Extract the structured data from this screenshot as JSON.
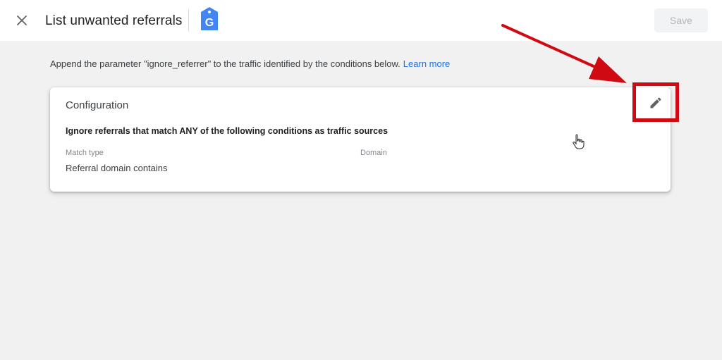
{
  "header": {
    "title": "List unwanted referrals",
    "save_label": "Save",
    "logo_letter": "G"
  },
  "description": {
    "text": "Append the parameter \"ignore_referrer\" to the traffic identified by the conditions below.",
    "link": "Learn more"
  },
  "configuration": {
    "title": "Configuration",
    "subtitle": "Ignore referrals that match ANY of the following conditions as traffic sources",
    "columns": [
      "Match type",
      "Domain"
    ],
    "match_type_value": "Referral domain contains",
    "domain_value": ""
  },
  "colors": {
    "brand_blue": "#4285f4",
    "link_blue": "#1a73e8",
    "highlight_red": "#d00a12",
    "background": "#f1f1f2"
  },
  "icons": [
    "close-icon",
    "gtm-tag-icon",
    "pencil-icon",
    "hand-cursor-icon"
  ]
}
